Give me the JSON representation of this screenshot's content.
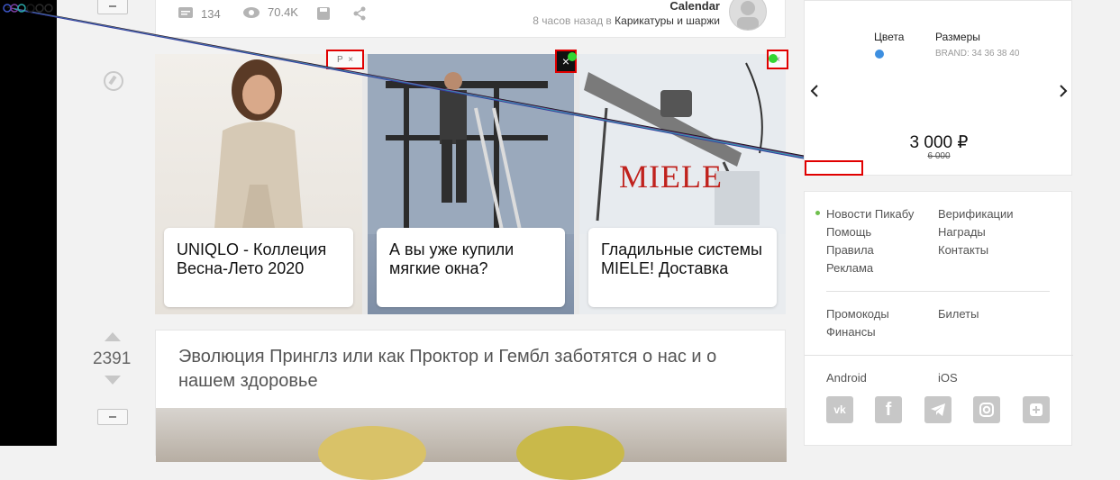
{
  "post_top": {
    "comments": "134",
    "views": "70.4K",
    "author": "Calendar",
    "time_ago": "8 часов назад в",
    "community": "Карикатуры и шаржи"
  },
  "ads": {
    "badge_p": "P",
    "close": "×",
    "cards": [
      {
        "caption": "UNIQLO - Коллеция Весна-Лето 2020"
      },
      {
        "caption": "А вы уже купили мягкие окна?"
      },
      {
        "caption": "Гладильные системы MIELE! Доставка",
        "brand_text": "MIELE"
      }
    ]
  },
  "post2": {
    "rating": "2391",
    "title": "Эволюция Принглз или как Проктор и Гембл заботятся о нас и о нашем здоровье"
  },
  "product_ad": {
    "colors_label": "Цвета",
    "sizes_label": "Размеры",
    "sizes_value": "BRAND: 34   36   38   40",
    "color_dot": "#3d8fe0",
    "price": "3 000 ₽",
    "old_price": "6 000"
  },
  "sidebar_links": {
    "col1": [
      "Новости Пикабу",
      "Помощь",
      "Правила",
      "Реклама"
    ],
    "col2": [
      "Верификации",
      "Награды",
      "Контакты"
    ],
    "col1b": [
      "Промокоды",
      "Финансы"
    ],
    "col2b": [
      "Билеты"
    ],
    "android": "Android",
    "ios": "iOS",
    "social": [
      "vk-icon",
      "facebook-icon",
      "telegram-icon",
      "instagram-icon",
      "pikabu-icon"
    ]
  },
  "colors": {
    "accent_green": "#4caf50",
    "ad_border_red": "#e10000"
  }
}
